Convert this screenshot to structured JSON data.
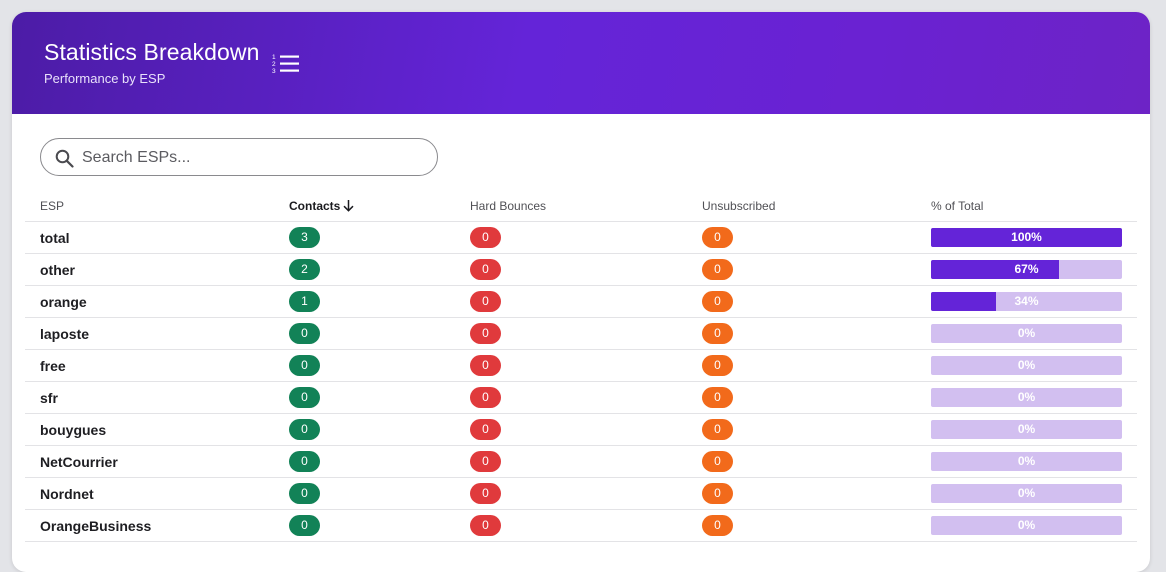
{
  "header": {
    "title": "Statistics Breakdown",
    "subtitle": "Performance by ESP"
  },
  "search": {
    "placeholder": "Search ESPs...",
    "value": ""
  },
  "table": {
    "columns": [
      "ESP",
      "Contacts",
      "Hard Bounces",
      "Unsubscribed",
      "% of Total"
    ],
    "sorted_column": "Contacts",
    "sort_direction": "descending",
    "rows": [
      {
        "esp": "total",
        "contacts": "3",
        "hard_bounces": "0",
        "unsubscribed": "0",
        "percent_label": "100%",
        "percent": 100
      },
      {
        "esp": "other",
        "contacts": "2",
        "hard_bounces": "0",
        "unsubscribed": "0",
        "percent_label": "67%",
        "percent": 67
      },
      {
        "esp": "orange",
        "contacts": "1",
        "hard_bounces": "0",
        "unsubscribed": "0",
        "percent_label": "34%",
        "percent": 34
      },
      {
        "esp": "laposte",
        "contacts": "0",
        "hard_bounces": "0",
        "unsubscribed": "0",
        "percent_label": "0%",
        "percent": 0
      },
      {
        "esp": "free",
        "contacts": "0",
        "hard_bounces": "0",
        "unsubscribed": "0",
        "percent_label": "0%",
        "percent": 0
      },
      {
        "esp": "sfr",
        "contacts": "0",
        "hard_bounces": "0",
        "unsubscribed": "0",
        "percent_label": "0%",
        "percent": 0
      },
      {
        "esp": "bouygues",
        "contacts": "0",
        "hard_bounces": "0",
        "unsubscribed": "0",
        "percent_label": "0%",
        "percent": 0
      },
      {
        "esp": "NetCourrier",
        "contacts": "0",
        "hard_bounces": "0",
        "unsubscribed": "0",
        "percent_label": "0%",
        "percent": 0
      },
      {
        "esp": "Nordnet",
        "contacts": "0",
        "hard_bounces": "0",
        "unsubscribed": "0",
        "percent_label": "0%",
        "percent": 0
      },
      {
        "esp": "OrangeBusiness",
        "contacts": "0",
        "hard_bounces": "0",
        "unsubscribed": "0",
        "percent_label": "0%",
        "percent": 0
      }
    ]
  },
  "icons": {
    "header_toggle": "numbered-list-icon",
    "search": "search-icon",
    "sort": "arrow-down-icon"
  },
  "colors": {
    "header_gradient_start": "#4c1ca6",
    "header_gradient_end": "#6d23c6",
    "contacts_badge": "#128257",
    "hard_bounce_badge": "#e03a3c",
    "unsubscribed_badge": "#f26a1b",
    "bar_fill": "#6424d8",
    "bar_track": "#d2bff0"
  }
}
